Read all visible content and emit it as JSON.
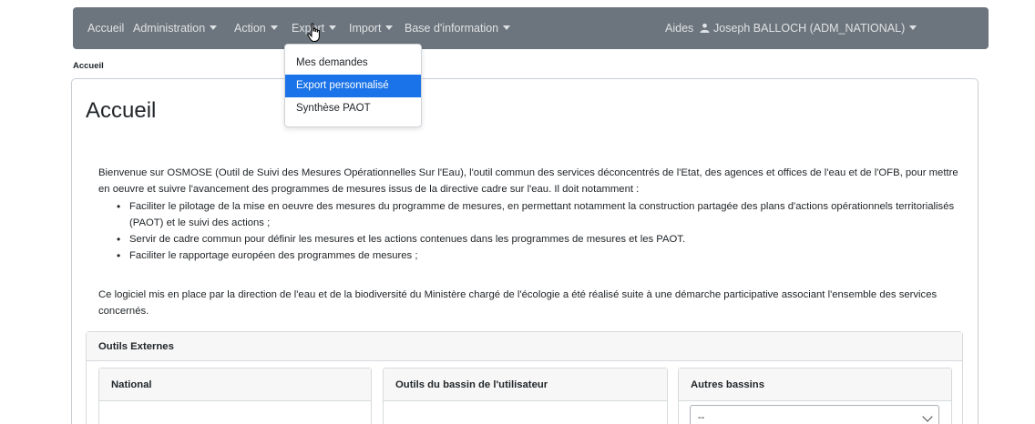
{
  "nav": {
    "items": [
      {
        "label": "Accueil",
        "dropdown": false
      },
      {
        "label": "Administration",
        "dropdown": true
      },
      {
        "label": "Action",
        "dropdown": true
      },
      {
        "label": "Export",
        "dropdown": true
      },
      {
        "label": "Import",
        "dropdown": true
      },
      {
        "label": "Base d'information",
        "dropdown": true
      }
    ],
    "help_label": "Aides",
    "user_label": "Joseph BALLOCH (ADM_NATIONAL)"
  },
  "export_menu": {
    "items": [
      "Mes demandes",
      "Export personnalisé",
      "Synthèse PAOT"
    ],
    "active_index": 1
  },
  "breadcrumb": "Accueil",
  "page_title": "Accueil",
  "content": {
    "intro": "Bienvenue sur OSMOSE (Outil de Suivi des Mesures Opérationnelles Sur l'Eau), l'outil commun des services déconcentrés de l'Etat, des agences et offices de l'eau et de l'OFB, pour mettre en oeuvre et suivre l'avancement des programmes de mesures issus de la directive cadre sur l'eau. Il doit notamment :",
    "bullets": [
      "Faciliter le pilotage de la mise en oeuvre des mesures du programme de mesures, en permettant notamment la construction partagée des plans d'actions opérationnels territorialisés (PAOT) et le suivi des actions ;",
      "Servir de cadre commun pour définir les mesures et les actions contenues dans les programmes de mesures et les PAOT.",
      "Faciliter le rapportage européen des programmes de mesures ;"
    ],
    "outro": "Ce logiciel mis en place par la direction de l'eau et de la biodiversité du Ministère chargé de l'écologie a été réalisé suite à une démarche participative associant l'ensemble des services concernés."
  },
  "external_tools": {
    "title": "Outils Externes",
    "columns": [
      "National",
      "Outils du bassin de l'utilisateur",
      "Autres bassins"
    ],
    "other_basins_select_value": "--"
  },
  "colors": {
    "navbar_bg": "#6c757d",
    "menu_active_bg": "#1a73e8"
  }
}
